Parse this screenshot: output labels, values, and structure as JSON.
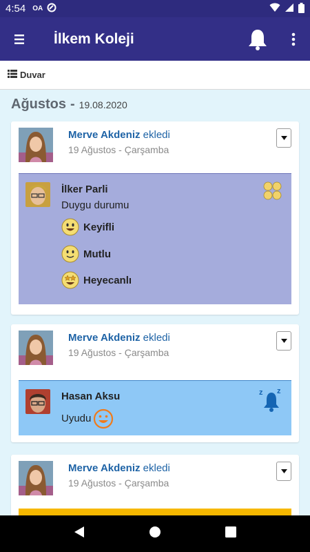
{
  "status_bar": {
    "time": "4:54",
    "left_icons": [
      "oa-icon",
      "sync-icon"
    ],
    "right_icons": [
      "wifi-icon",
      "signal-icon",
      "battery-icon"
    ]
  },
  "app_bar": {
    "title": "İlkem Koleji"
  },
  "tab": {
    "label": "Duvar"
  },
  "date_header": {
    "month": "Ağustos",
    "separator": "-",
    "date": "19.08.2020"
  },
  "posts": [
    {
      "author": "Merve Akdeniz",
      "action": " ekledi",
      "date": "19 Ağustos - Çarşamba",
      "child": "İlker Parli",
      "subtitle": "Duygu durumu",
      "moods": [
        "Keyifli",
        "Mutlu",
        "Heyecanlı"
      ]
    },
    {
      "author": "Merve Akdeniz",
      "action": " ekledi",
      "date": "19 Ağustos - Çarşamba",
      "child": "Hasan Aksu",
      "subtitle": "Uyudu"
    },
    {
      "author": "Merve Akdeniz",
      "action": " ekledi",
      "date": "19 Ağustos - Çarşamba"
    }
  ],
  "colors": {
    "app_bar": "#332f87",
    "background": "#e2f4fb",
    "author_link": "#1e63a6",
    "mood_panel": "#a5acdc",
    "sleep_panel": "#8ec8f6",
    "third_panel": "#f6b800"
  }
}
